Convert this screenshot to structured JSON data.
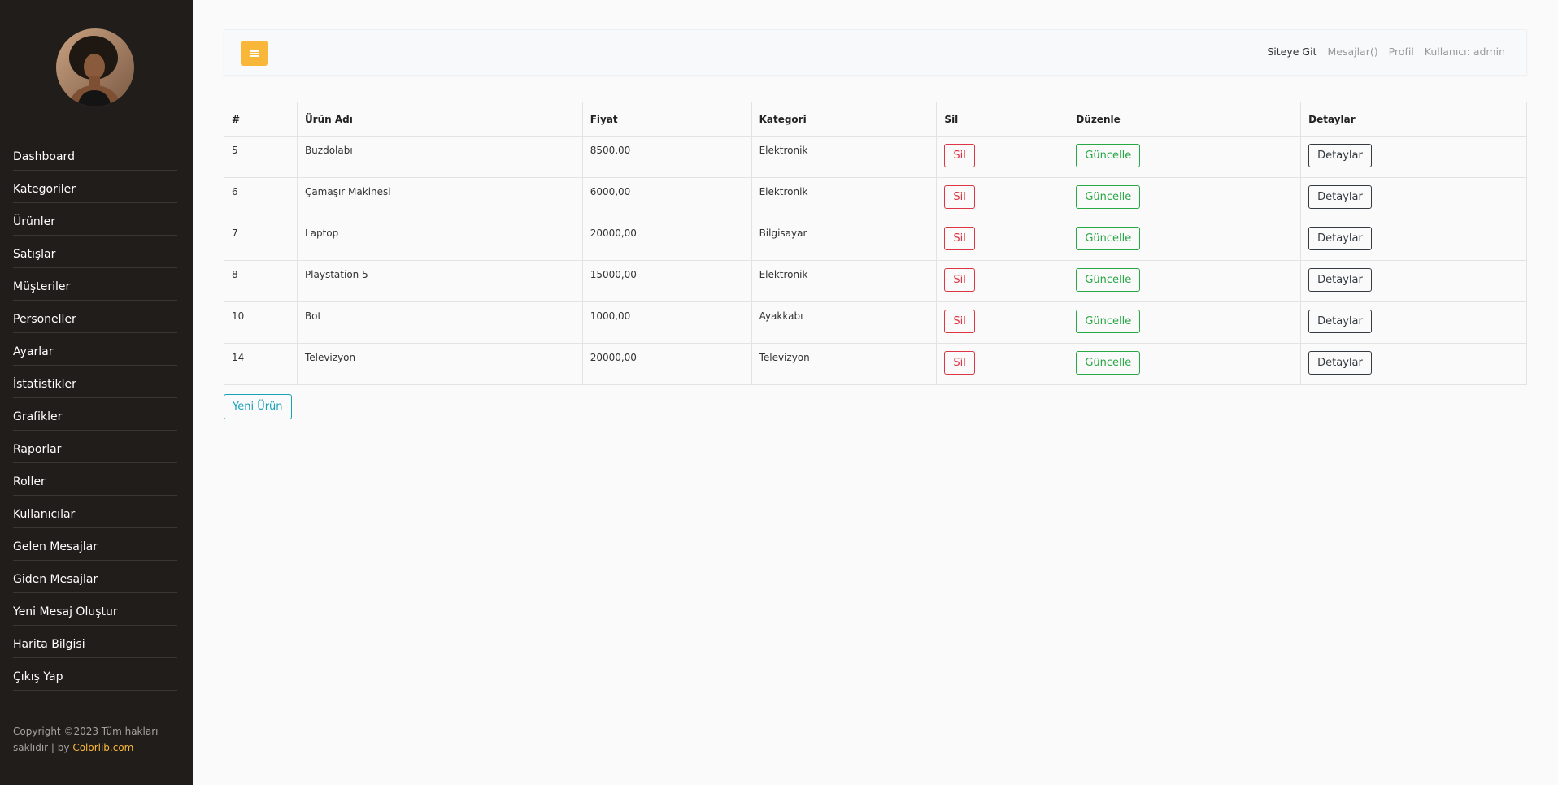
{
  "sidebar": {
    "items": [
      {
        "label": "Dashboard"
      },
      {
        "label": "Kategoriler"
      },
      {
        "label": "Ürünler"
      },
      {
        "label": "Satışlar"
      },
      {
        "label": "Müşteriler"
      },
      {
        "label": "Personeller"
      },
      {
        "label": "Ayarlar"
      },
      {
        "label": "İstatistikler"
      },
      {
        "label": "Grafikler"
      },
      {
        "label": "Raporlar"
      },
      {
        "label": "Roller"
      },
      {
        "label": "Kullanıcılar"
      },
      {
        "label": "Gelen Mesajlar"
      },
      {
        "label": "Giden Mesajlar"
      },
      {
        "label": "Yeni Mesaj Oluştur"
      },
      {
        "label": "Harita Bilgisi"
      },
      {
        "label": "Çıkış Yap"
      }
    ],
    "footer": {
      "text": "Copyright ©2023 Tüm hakları saklıdır | by ",
      "link": "Colorlib.com"
    }
  },
  "topbar": {
    "links": {
      "site": "Siteye Git",
      "messages": "Mesajlar()",
      "profile": "Profil",
      "user": "Kullanıcı: admin"
    }
  },
  "table": {
    "headers": {
      "id": "#",
      "name": "Ürün Adı",
      "price": "Fiyat",
      "category": "Kategori",
      "delete": "Sil",
      "edit": "Düzenle",
      "details": "Detaylar"
    },
    "rows": [
      {
        "id": "5",
        "name": "Buzdolabı",
        "price": "8500,00",
        "category": "Elektronik",
        "delete": "Sil",
        "edit": "Güncelle",
        "details": "Detaylar"
      },
      {
        "id": "6",
        "name": "Çamaşır Makinesi",
        "price": "6000,00",
        "category": "Elektronik",
        "delete": "Sil",
        "edit": "Güncelle",
        "details": "Detaylar"
      },
      {
        "id": "7",
        "name": "Laptop",
        "price": "20000,00",
        "category": "Bilgisayar",
        "delete": "Sil",
        "edit": "Güncelle",
        "details": "Detaylar"
      },
      {
        "id": "8",
        "name": "Playstation 5",
        "price": "15000,00",
        "category": "Elektronik",
        "delete": "Sil",
        "edit": "Güncelle",
        "details": "Detaylar"
      },
      {
        "id": "10",
        "name": "Bot",
        "price": "1000,00",
        "category": "Ayakkabı",
        "delete": "Sil",
        "edit": "Güncelle",
        "details": "Detaylar"
      },
      {
        "id": "14",
        "name": "Televizyon",
        "price": "20000,00",
        "category": "Televizyon",
        "delete": "Sil",
        "edit": "Güncelle",
        "details": "Detaylar"
      }
    ]
  },
  "new_button": "Yeni Ürün",
  "colors": {
    "sidebar_bg": "#211d1b",
    "accent": "#f8b739",
    "danger": "#dc3545",
    "success": "#28a745",
    "dark": "#343a40",
    "info": "#17a2b8"
  }
}
